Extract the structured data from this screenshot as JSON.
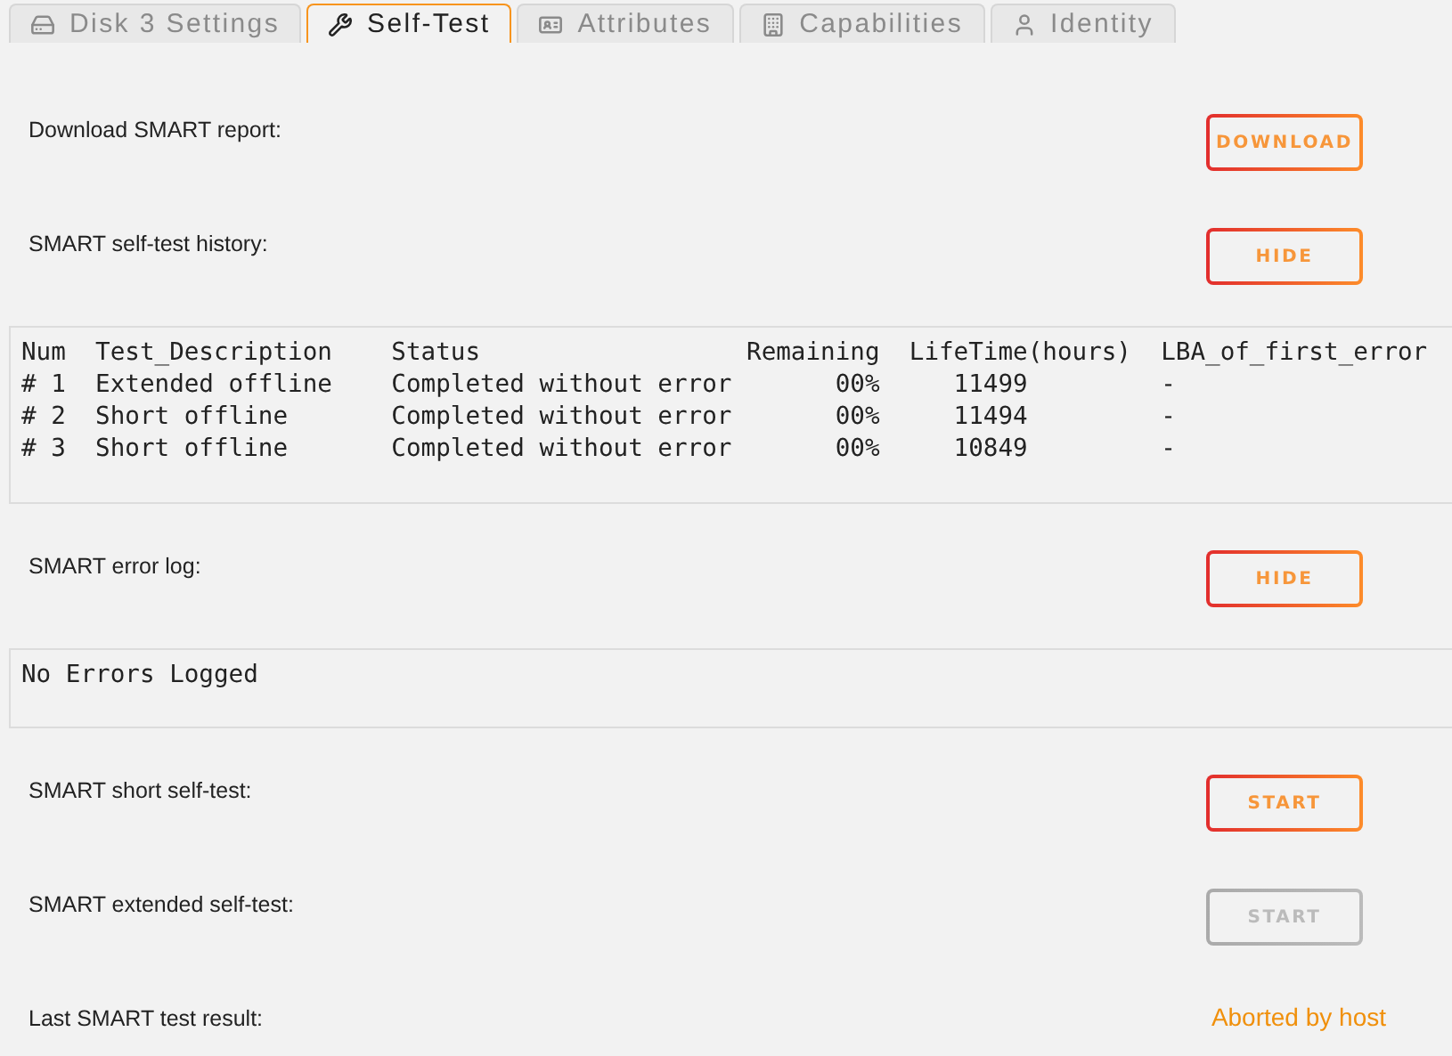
{
  "tabs": [
    {
      "label": "Disk 3 Settings",
      "kind": "drive",
      "selected": false
    },
    {
      "label": "Self-Test",
      "kind": "wrench",
      "selected": true
    },
    {
      "label": "Attributes",
      "kind": "card",
      "selected": false
    },
    {
      "label": "Capabilities",
      "kind": "building",
      "selected": false
    },
    {
      "label": "Identity",
      "kind": "user",
      "selected": false
    }
  ],
  "sections": [
    {
      "kind": "action",
      "label": "Download SMART report:",
      "button": {
        "label": "DOWNLOAD",
        "disabled": false
      }
    },
    {
      "kind": "action",
      "label": "SMART self-test history:",
      "button": {
        "label": "HIDE",
        "disabled": false
      }
    },
    {
      "kind": "log",
      "lines": [
        "Num  Test_Description    Status                  Remaining  LifeTime(hours)  LBA_of_first_error",
        "# 1  Extended offline    Completed without error       00%     11499         -",
        "# 2  Short offline       Completed without error       00%     11494         -",
        "# 3  Short offline       Completed without error       00%     10849         -"
      ]
    },
    {
      "kind": "action",
      "label": "SMART error log:",
      "button": {
        "label": "HIDE",
        "disabled": false
      }
    },
    {
      "kind": "log",
      "lines": [
        "No Errors Logged"
      ]
    },
    {
      "kind": "action",
      "label": "SMART short self-test:",
      "button": {
        "label": "START",
        "disabled": false
      }
    },
    {
      "kind": "action",
      "label": "SMART extended self-test:",
      "button": {
        "label": "START",
        "disabled": true
      }
    },
    {
      "kind": "result",
      "label": "Last SMART test result:",
      "value": "Aborted by host"
    }
  ]
}
